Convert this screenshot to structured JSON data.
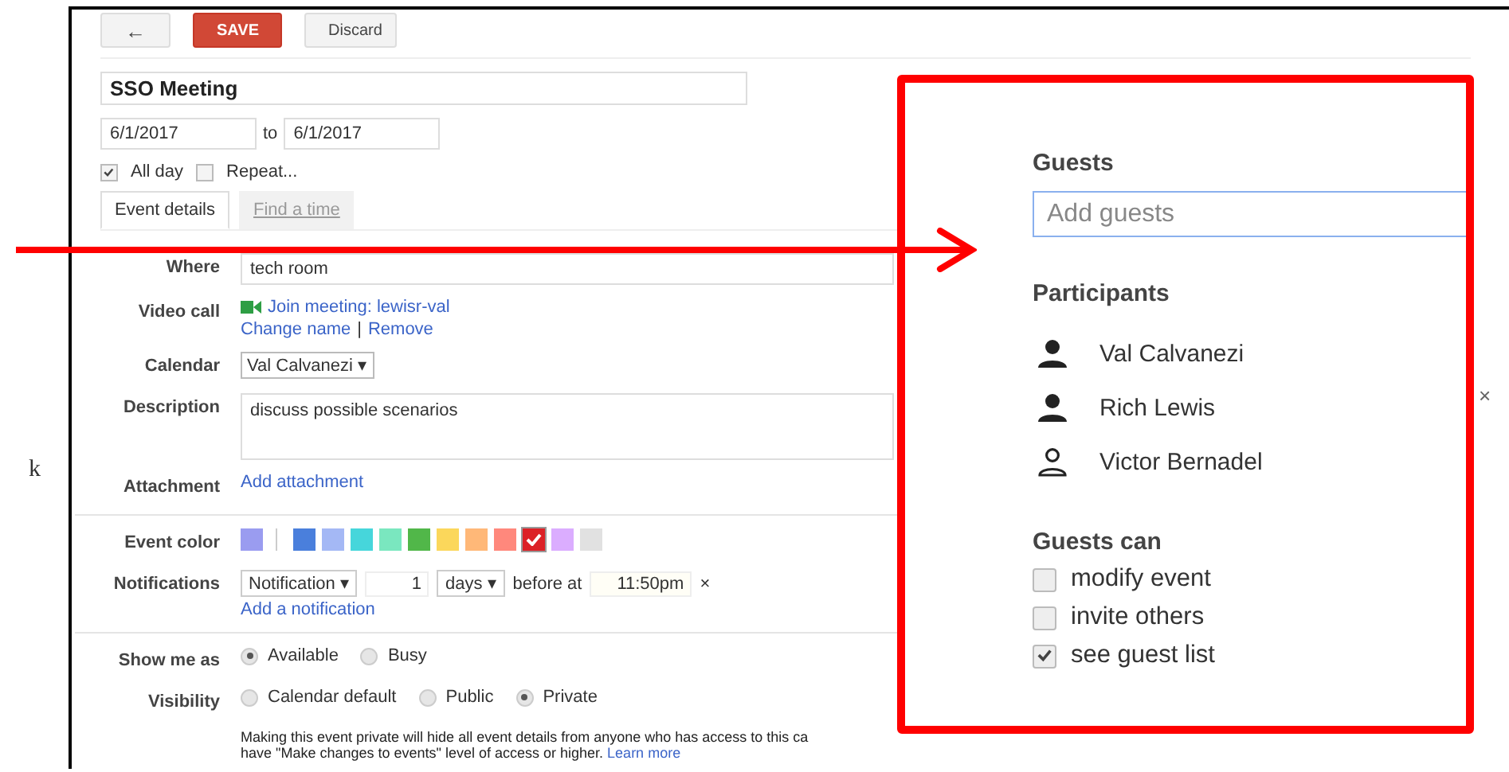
{
  "toolbar": {
    "back": "←",
    "save": "SAVE",
    "discard": "Discard"
  },
  "event": {
    "title": "SSO Meeting",
    "start_date": "6/1/2017",
    "to": "to",
    "end_date": "6/1/2017",
    "options": [
      {
        "label": "All day",
        "checked": true
      },
      {
        "label": "Repeat...",
        "checked": false
      }
    ]
  },
  "tabs": [
    {
      "label": "Event details",
      "selected": true
    },
    {
      "label": "Find a time",
      "selected": false
    }
  ],
  "details": {
    "where_label": "Where",
    "where": "tech room",
    "video_label": "Video call",
    "join": "Join meeting: lewisr-val",
    "change_name": "Change name",
    "separator": "|",
    "remove": "Remove",
    "calendar_label": "Calendar",
    "calendar": "Val Calvanezi ▾",
    "description_label": "Description",
    "description": "discuss possible scenarios",
    "attachment_label": "Attachment",
    "add_attachment": "Add attachment"
  },
  "event_color": {
    "label": "Event color",
    "default": {
      "color": "#9a9cf0",
      "selected": false
    },
    "swatches": [
      {
        "color": "#4a7fdc",
        "selected": false
      },
      {
        "color": "#a4b8f5",
        "selected": false
      },
      {
        "color": "#46d6db",
        "selected": false
      },
      {
        "color": "#7ae7bf",
        "selected": false
      },
      {
        "color": "#51b749",
        "selected": false
      },
      {
        "color": "#fbd75b",
        "selected": false
      },
      {
        "color": "#ffb878",
        "selected": false
      },
      {
        "color": "#ff887c",
        "selected": false
      },
      {
        "color": "#dc2127",
        "selected": true
      },
      {
        "color": "#dbadff",
        "selected": false
      },
      {
        "color": "#e1e1e1",
        "selected": false
      }
    ]
  },
  "notifications": {
    "label": "Notifications",
    "method": "Notification ▾",
    "amount": "1",
    "unit": "days ▾",
    "before": "before at",
    "time": "11:50pm",
    "remove": "×",
    "add": "Add a notification"
  },
  "show_me_as": {
    "label": "Show me as",
    "options": [
      {
        "label": "Available",
        "selected": true
      },
      {
        "label": "Busy",
        "selected": false
      }
    ]
  },
  "visibility": {
    "label": "Visibility",
    "options": [
      {
        "label": "Calendar default",
        "selected": false
      },
      {
        "label": "Public",
        "selected": false
      },
      {
        "label": "Private",
        "selected": true
      }
    ],
    "note_lines": [
      "Making this event private will hide all event details from anyone who has access to this ca",
      "have \"Make changes to events\" level of access or higher."
    ],
    "learn_more": "Learn more"
  },
  "side_mark": "×",
  "outside_fragment": "k",
  "callout": {
    "guests_title": "Guests",
    "guests_placeholder": "Add guests",
    "participants_title": "Participants",
    "participants": [
      {
        "name": "Val Calvanezi",
        "kind": "filled"
      },
      {
        "name": "Rich Lewis",
        "kind": "filled"
      },
      {
        "name": "Victor Bernadel",
        "kind": "outline"
      }
    ],
    "permissions_title": "Guests can",
    "permissions": [
      {
        "label": "modify event",
        "checked": false
      },
      {
        "label": "invite others",
        "checked": false
      },
      {
        "label": "see guest list",
        "checked": true
      }
    ]
  }
}
